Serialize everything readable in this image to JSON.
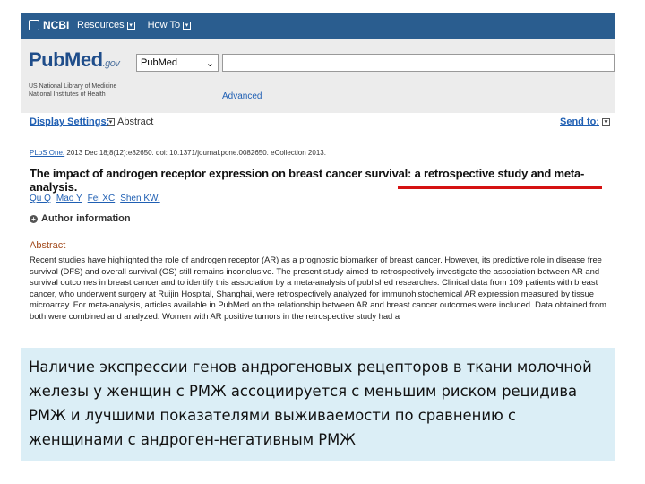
{
  "ncbi": {
    "logo": "NCBI",
    "menu": [
      "Resources",
      "How To"
    ]
  },
  "pubmed": {
    "logo_main": "PubMed",
    "logo_gov": ".gov",
    "sub_line1": "US National Library of Medicine",
    "sub_line2": "National Institutes of Health",
    "db_select_value": "PubMed",
    "search_value": "",
    "advanced": "Advanced"
  },
  "settings": {
    "display_settings": "Display Settings:",
    "display_value": "Abstract",
    "send_to": "Send to:"
  },
  "article": {
    "journal": "PLoS One.",
    "citation": "2013 Dec 18;8(12):e82650. doi: 10.1371/journal.pone.0082650. eCollection 2013.",
    "title": "The impact of androgen receptor expression on breast cancer survival: a retrospective study and meta-analysis.",
    "authors": [
      "Qu Q",
      "Mao Y",
      "Fei XC",
      "Shen KW."
    ],
    "author_info": "Author information",
    "abstract_heading": "Abstract",
    "abstract_text": "Recent studies have highlighted the role of androgen receptor (AR) as a prognostic biomarker of breast cancer. However, its predictive role in disease free survival (DFS) and overall survival (OS) still remains inconclusive. The present study aimed to retrospectively investigate the association between AR and survival outcomes in breast cancer and to identify this association by a meta-analysis of published researches. Clinical data from 109 patients with breast cancer, who underwent surgery at Ruijin Hospital, Shanghai, were retrospectively analyzed for immunohistochemical AR expression measured by tissue microarray. For meta-analysis, articles available in PubMed on the relationship between AR and breast cancer outcomes were included. Data obtained from both were combined and analyzed. Women with AR positive tumors in the retrospective study had a"
  },
  "overlay": {
    "text": "Наличие экспрессии генов андрогеновых рецепторов в ткани молочной железы у женщин с РМЖ ассоциируется с меньшим риском рецидива РМЖ и лучшими показателями выживаемости по сравнению с женщинами с андроген-негативным РМЖ"
  },
  "colors": {
    "ncbi_bar": "#2a5d8f",
    "link": "#1f5fb3",
    "highlight_underline": "#d51212",
    "abstract_heading": "#a24a1c",
    "overlay_bg": "#dbeef6"
  }
}
